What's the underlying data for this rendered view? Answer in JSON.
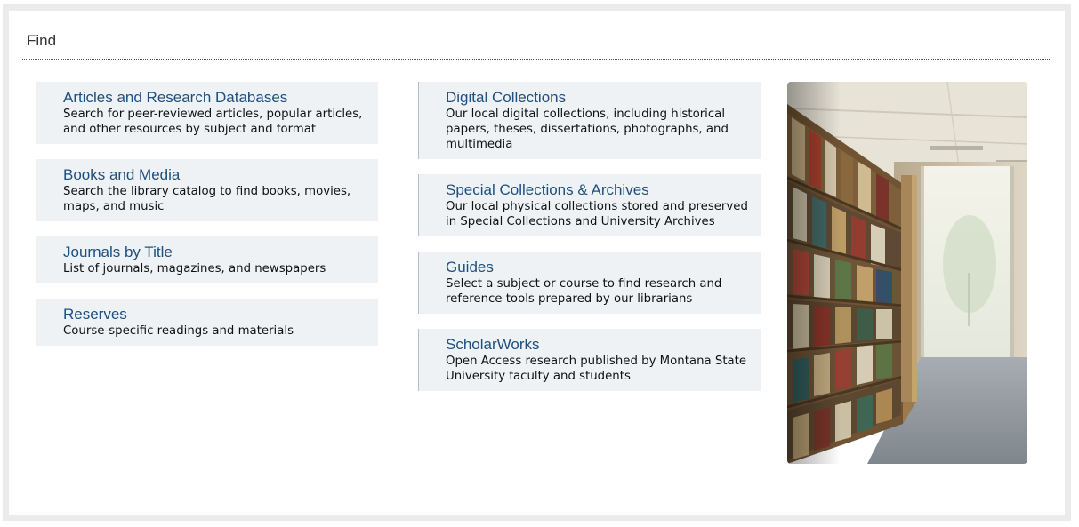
{
  "section": {
    "title": "Find"
  },
  "left_column": [
    {
      "title": "Articles and Research Databases",
      "description": "Search for peer-reviewed articles, popular articles, and other resources by subject and format"
    },
    {
      "title": "Books and Media",
      "description": "Search the library catalog to find books, movies, maps, and music"
    },
    {
      "title": "Journals by Title",
      "description": "List of journals, magazines, and newspapers"
    },
    {
      "title": "Reserves",
      "description": "Course-specific readings and materials"
    }
  ],
  "middle_column": [
    {
      "title": "Digital Collections",
      "description": "Our local digital collections, including historical papers, theses, dissertations, photographs, and multimedia"
    },
    {
      "title": "Special Collections & Archives",
      "description": "Our local physical collections stored and preserved in Special Collections and University Archives"
    },
    {
      "title": "Guides",
      "description": "Select a subject or course to find research and reference tools prepared by our librarians"
    },
    {
      "title": "ScholarWorks",
      "description": "Open Access research published by Montana State University faculty and students"
    }
  ],
  "colors": {
    "link": "#1e4f7f",
    "card_background": "#eef2f5",
    "frame_border": "#ebebeb"
  },
  "image": {
    "subject": "library-bookshelves-photo"
  }
}
